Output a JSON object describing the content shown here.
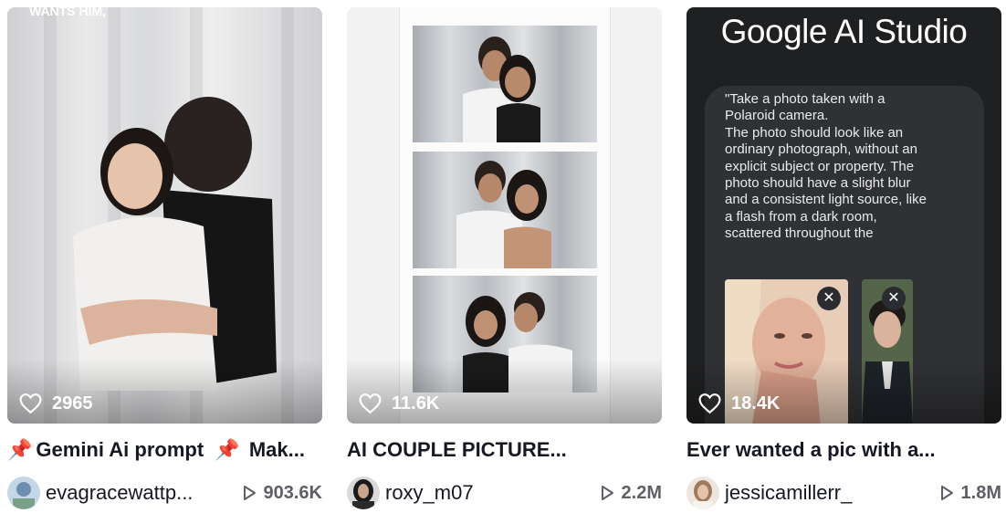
{
  "cards": [
    {
      "overlay_caption": "WANTS HIM,",
      "likes": "2965",
      "title_pin_left": "📌",
      "title_text": "Gemini Ai prompt",
      "title_pin_right": "📌",
      "title_tail": "Mak...",
      "username": "evagracewattp...",
      "plays": "903.6K"
    },
    {
      "likes": "11.6K",
      "title_text": "AI COUPLE PICTURE...",
      "username": "roxy_m07",
      "plays": "2.2M"
    },
    {
      "likes": "18.4K",
      "title_text": "Ever wanted a pic with a...",
      "username": "jessicamillerr_",
      "plays": "1.8M",
      "studio_title": "Google AI Studio",
      "prompt_text": "\"Take a photo taken with a Polaroid camera.\nThe photo should look like an ordinary photograph, without an explicit subject or property. The photo should have a slight blur and a consistent light source, like a flash from a dark room, scattered throughout the"
    }
  ],
  "icons": {
    "like": "heart-outline-icon",
    "plays": "play-outline-icon",
    "pin": "pushpin-icon",
    "remove": "close-icon",
    "send": "arrow-up-icon",
    "add": "plus-icon"
  },
  "colors": {
    "text": "#161823",
    "muted": "#5e5f66",
    "send": "#b0a02a",
    "panel": "#303134"
  }
}
